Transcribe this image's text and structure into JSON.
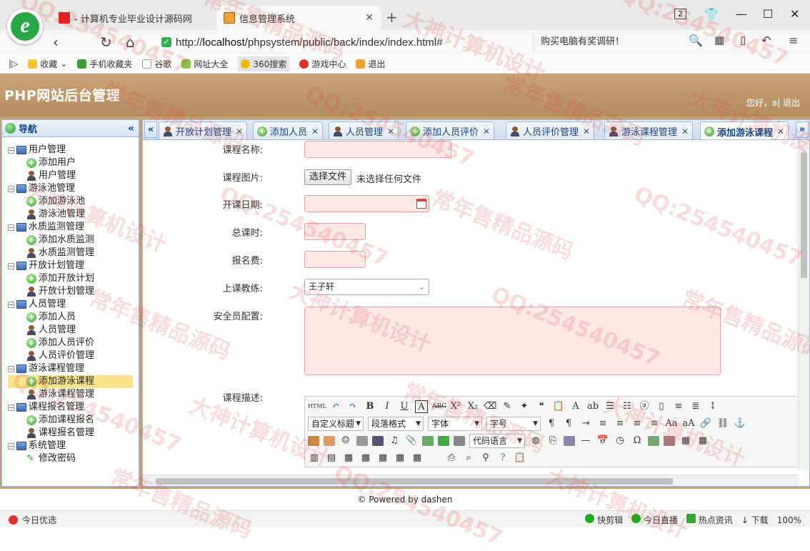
{
  "browser": {
    "tabs": [
      {
        "title": "- 计算机专业毕业设计源码网",
        "active": false
      },
      {
        "title": "信息管理系统",
        "active": true
      }
    ],
    "url_prefix": "http://",
    "url_host": "localhost",
    "url_path": "/phpsystem/public/back/index/index.html#",
    "search_text": "购买电脑有奖调研！",
    "page_count_badge": "2",
    "bookmarks": [
      "收藏",
      "手机收藏夹",
      "谷歌",
      "网址大全",
      "360搜索",
      "游戏中心",
      "退出"
    ]
  },
  "app": {
    "title": "PHP网站后台管理",
    "welcome": "您好，a|",
    "logout": "退出",
    "footer": "© Powered by dashen"
  },
  "sidebar": {
    "title": "导航",
    "groups": [
      {
        "label": "用户管理",
        "items": [
          {
            "label": "添加用户",
            "icon": "add"
          },
          {
            "label": "用户管理",
            "icon": "user"
          }
        ]
      },
      {
        "label": "游泳池管理",
        "items": [
          {
            "label": "添加游泳池",
            "icon": "add"
          },
          {
            "label": "游泳池管理",
            "icon": "user"
          }
        ]
      },
      {
        "label": "水质监测管理",
        "items": [
          {
            "label": "添加水质监测",
            "icon": "add"
          },
          {
            "label": "水质监测管理",
            "icon": "user"
          }
        ]
      },
      {
        "label": "开放计划管理",
        "items": [
          {
            "label": "添加开放计划",
            "icon": "add"
          },
          {
            "label": "开放计划管理",
            "icon": "user"
          }
        ]
      },
      {
        "label": "人员管理",
        "items": [
          {
            "label": "添加人员",
            "icon": "add"
          },
          {
            "label": "人员管理",
            "icon": "user"
          },
          {
            "label": "添加人员评价",
            "icon": "add"
          },
          {
            "label": "人员评价管理",
            "icon": "user"
          }
        ]
      },
      {
        "label": "游泳课程管理",
        "items": [
          {
            "label": "添加游泳课程",
            "icon": "add",
            "selected": true
          },
          {
            "label": "游泳课程管理",
            "icon": "user"
          }
        ]
      },
      {
        "label": "课程报名管理",
        "items": [
          {
            "label": "添加课程报名",
            "icon": "add"
          },
          {
            "label": "课程报名管理",
            "icon": "user"
          }
        ]
      },
      {
        "label": "系统管理",
        "items": [
          {
            "label": "修改密码",
            "icon": "pen"
          }
        ]
      }
    ]
  },
  "tabs": [
    {
      "label": "开放计划管理",
      "icon": "user"
    },
    {
      "label": "添加人员",
      "icon": "add"
    },
    {
      "label": "人员管理",
      "icon": "user"
    },
    {
      "label": "添加人员评价",
      "icon": "add"
    },
    {
      "label": "人员评价管理",
      "icon": "user"
    },
    {
      "label": "游泳课程管理",
      "icon": "user"
    },
    {
      "label": "添加游泳课程",
      "icon": "add",
      "active": true
    }
  ],
  "form": {
    "course_name_label": "课程名称:",
    "course_image_label": "课程图片:",
    "file_button": "选择文件",
    "file_status": "未选择任何文件",
    "start_date_label": "开课日期:",
    "total_hours_label": "总课时:",
    "fee_label": "报名费:",
    "coach_label": "上课教练:",
    "coach_value": "王子轩",
    "safety_label": "安全员配置:",
    "description_label": "课程描述:"
  },
  "editor": {
    "html_btn": "HTML",
    "style_dd": "自定义标题",
    "para_dd": "段落格式",
    "font_dd": "字体",
    "size_dd": "字号",
    "code_dd": "代码语言"
  },
  "statusbar": {
    "left": "今日优选",
    "items": [
      "快剪辑",
      "今日直播",
      "热点资讯",
      "下载"
    ],
    "zoom": "100%"
  },
  "watermark_texts": [
    "QQ:254540457",
    "常年售精品源码",
    "大神计算机设计"
  ]
}
